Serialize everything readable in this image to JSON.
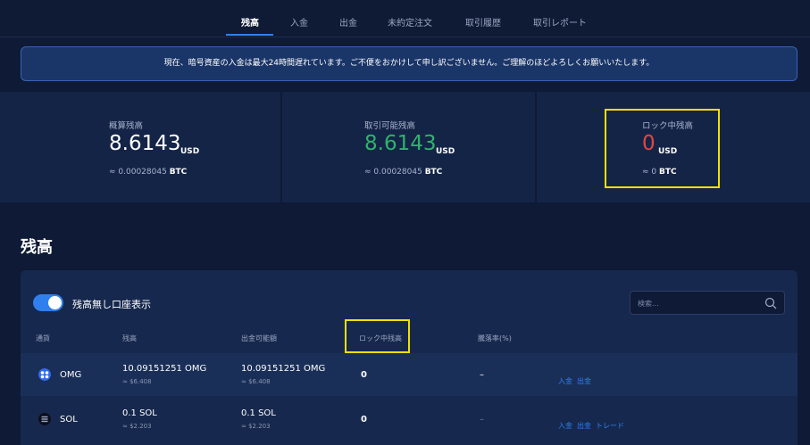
{
  "nav": {
    "tabs": [
      {
        "label": "残高"
      },
      {
        "label": "入金"
      },
      {
        "label": "出金"
      },
      {
        "label": "未約定注文"
      },
      {
        "label": "取引履歴"
      },
      {
        "label": "取引レポート"
      }
    ],
    "active_tab": "残高"
  },
  "notice": {
    "text": "現在、暗号資産の入金は最大24時間遅れています。ご不便をおかけして申し訳ございません。ご理解のほどよろしくお願いいたします。"
  },
  "summary": {
    "estimated": {
      "label": "概算残高",
      "value": "8.6143",
      "unit": "USD",
      "btc_prefix": "≈ 0.00028045",
      "btc_unit": "BTC"
    },
    "available": {
      "label": "取引可能残高",
      "value": "8.6143",
      "unit": "USD",
      "btc_prefix": "≈ 0.00028045",
      "btc_unit": "BTC"
    },
    "locked": {
      "label": "ロック中残高",
      "value": "0",
      "unit": "USD",
      "btc_prefix": "≈ 0",
      "btc_unit": "BTC"
    }
  },
  "balance": {
    "title": "残高",
    "toggle_label": "残高無し口座表示",
    "toggle_on": true,
    "search_placeholder": "検索...",
    "columns": [
      "通貨",
      "残高",
      "出金可能額",
      "ロック中残高",
      "騰落率(%)"
    ],
    "rows": [
      {
        "coin": "OMG",
        "balance": "10.09151251 OMG",
        "balance_usd": "≈ $6.408",
        "withdrawable": "10.09151251 OMG",
        "withdrawable_usd": "≈ $6.408",
        "locked": "0",
        "change": "–",
        "actions": [
          "入金",
          "出金"
        ]
      },
      {
        "coin": "SOL",
        "balance": "0.1 SOL",
        "balance_usd": "≈ $2.203",
        "withdrawable": "0.1 SOL",
        "withdrawable_usd": "≈ $2.203",
        "locked": "0",
        "change": "–",
        "actions": [
          "入金",
          "出金",
          "トレード"
        ]
      }
    ]
  },
  "colors": {
    "background": "#0e1a36",
    "card": "#142447",
    "accent": "#2f80ed",
    "green": "#2fb36b",
    "red": "#e2463f",
    "highlight": "#f2e200"
  }
}
